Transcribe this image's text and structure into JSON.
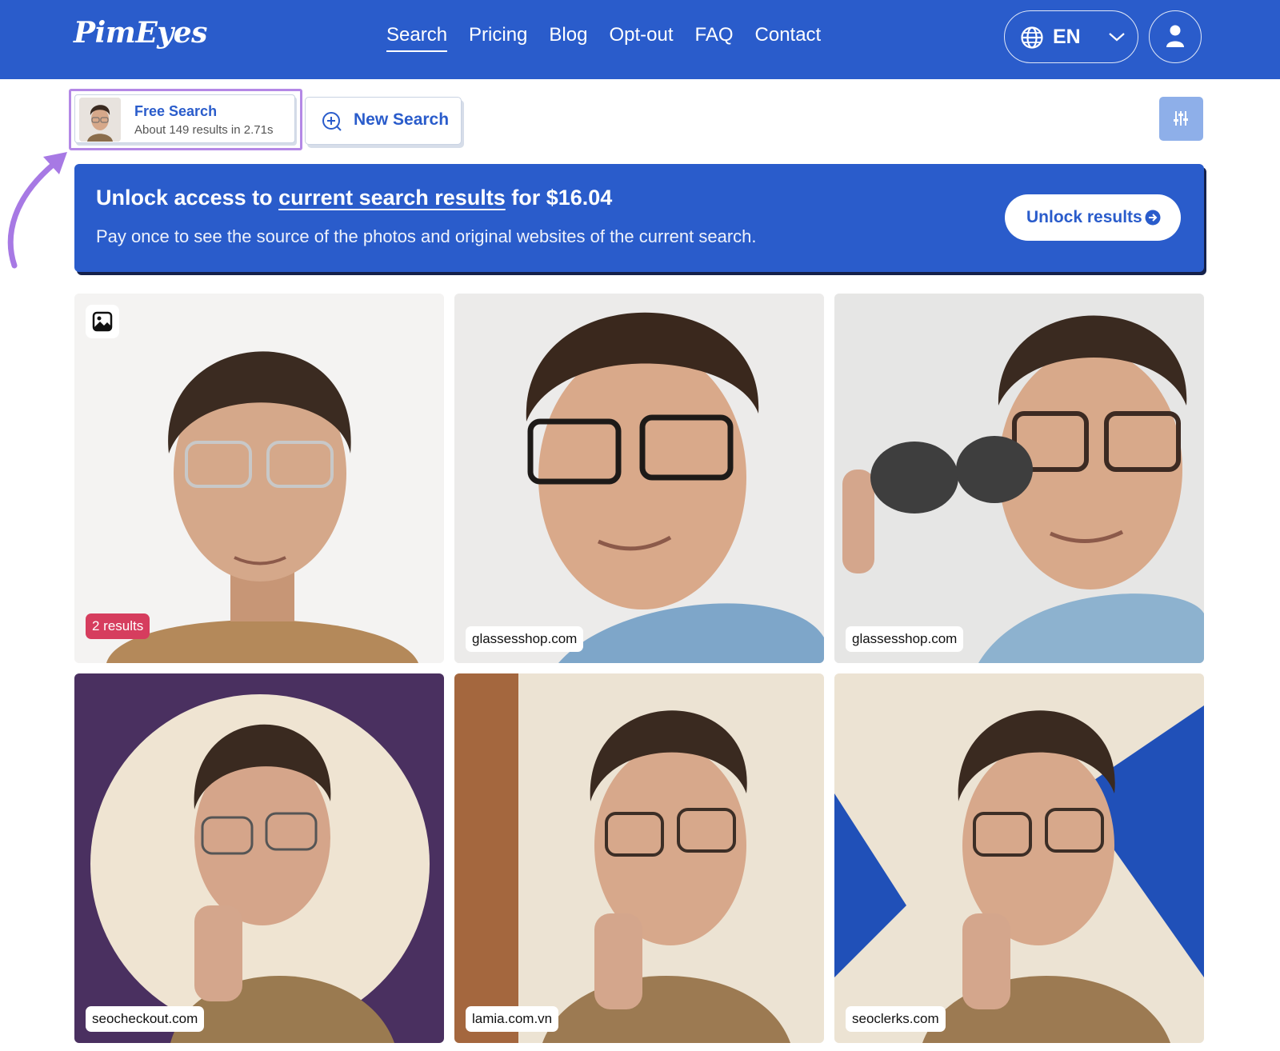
{
  "header": {
    "logo": "PimEyes",
    "nav": [
      "Search",
      "Pricing",
      "Blog",
      "Opt-out",
      "FAQ",
      "Contact"
    ],
    "language": "EN",
    "colors": {
      "brand": "#2a5ccb"
    }
  },
  "toolbar": {
    "free_search_title": "Free Search",
    "free_search_sub": "About 149 results in 2.71s",
    "new_search_label": "New Search"
  },
  "banner": {
    "title_prefix": "Unlock access to ",
    "title_link": "current search results",
    "title_suffix": " for $16.04",
    "subtitle": "Pay once to see the source of the photos and original websites of the current search.",
    "button_label": "Unlock results"
  },
  "results": [
    {
      "tag": "2 results",
      "type": "count"
    },
    {
      "tag": "glassesshop.com",
      "type": "site"
    },
    {
      "tag": "glassesshop.com",
      "type": "site"
    },
    {
      "tag": "seocheckout.com",
      "type": "site"
    },
    {
      "tag": "lamia.com.vn",
      "type": "site"
    },
    {
      "tag": "seoclerks.com",
      "type": "site"
    }
  ]
}
